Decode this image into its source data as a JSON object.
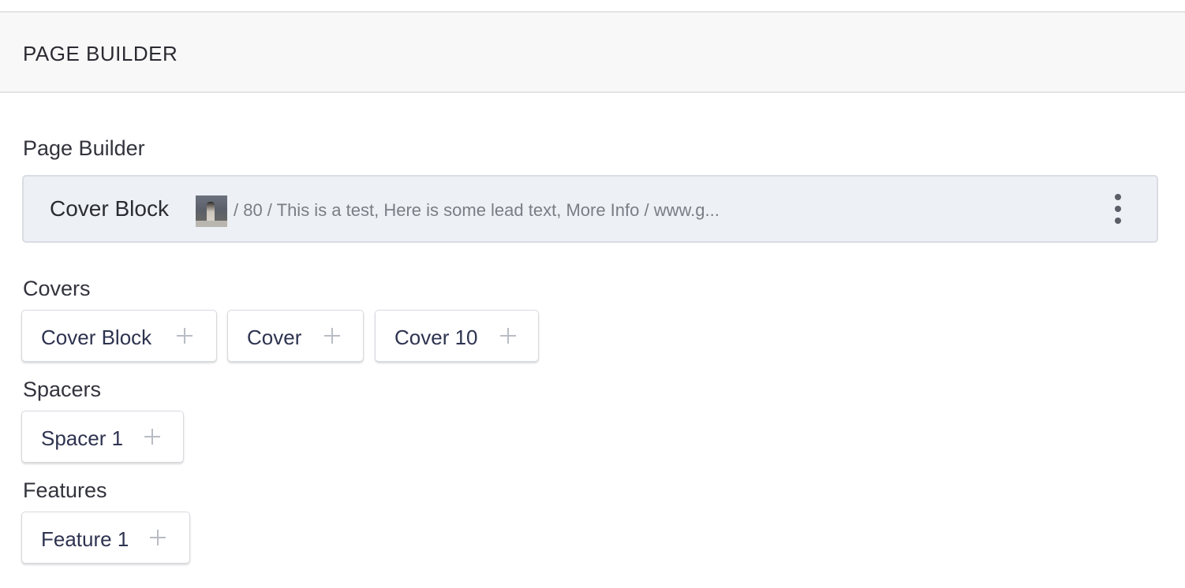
{
  "panel": {
    "title": "PAGE BUILDER"
  },
  "field": {
    "label": "Page Builder"
  },
  "existing_block": {
    "name": "Cover Block",
    "thumbnail": "cover-image-thumbnail",
    "summary": "/ 80 / This is a test, Here is some lead text, More Info / www.g...",
    "menu_icon": "more-vertical-icon"
  },
  "groups": [
    {
      "label": "Covers",
      "buttons": [
        {
          "label": "Cover Block",
          "icon": "plus-icon"
        },
        {
          "label": "Cover",
          "icon": "plus-icon"
        },
        {
          "label": "Cover 10",
          "icon": "plus-icon"
        }
      ]
    },
    {
      "label": "Spacers",
      "buttons": [
        {
          "label": "Spacer 1",
          "icon": "plus-icon"
        }
      ]
    },
    {
      "label": "Features",
      "buttons": [
        {
          "label": "Feature 1",
          "icon": "plus-icon"
        }
      ]
    }
  ],
  "colors": {
    "header_bg": "#f8f8f8",
    "block_row_bg": "#edf0f4",
    "button_text": "#2e3350",
    "plus_icon": "#b8bcc4"
  }
}
